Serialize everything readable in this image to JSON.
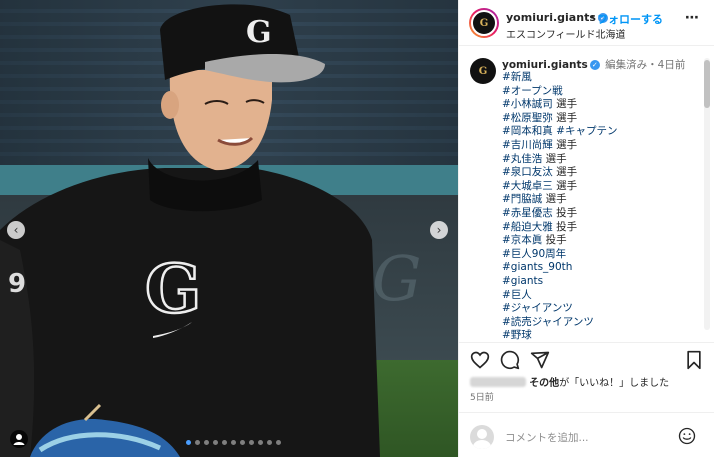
{
  "header": {
    "username": "yomiuri.giants",
    "separator": "•",
    "follow_label": "フォローする",
    "location": "エスコンフィールド北海道",
    "more_icon": "more-horizontal-icon"
  },
  "caption": {
    "username": "yomiuri.giants",
    "meta": "編集済み・4日前",
    "lines": [
      [
        {
          "text": "#新風",
          "hashtag": true
        }
      ],
      [
        {
          "text": "#オープン戦",
          "hashtag": true
        }
      ],
      [
        {
          "text": "#小林誠司",
          "hashtag": true
        },
        {
          "text": " 選手",
          "hashtag": false
        }
      ],
      [
        {
          "text": "#松原聖弥",
          "hashtag": true
        },
        {
          "text": " 選手",
          "hashtag": false
        }
      ],
      [
        {
          "text": "#岡本和真",
          "hashtag": true
        },
        {
          "text": " ",
          "hashtag": false
        },
        {
          "text": "#キャプテン",
          "hashtag": true
        }
      ],
      [
        {
          "text": "#吉川尚輝",
          "hashtag": true
        },
        {
          "text": " 選手",
          "hashtag": false
        }
      ],
      [
        {
          "text": "#丸佳浩",
          "hashtag": true
        },
        {
          "text": " 選手",
          "hashtag": false
        }
      ],
      [
        {
          "text": "#泉口友汰",
          "hashtag": true
        },
        {
          "text": " 選手",
          "hashtag": false
        }
      ],
      [
        {
          "text": "#大城卓三",
          "hashtag": true
        },
        {
          "text": " 選手",
          "hashtag": false
        }
      ],
      [
        {
          "text": "#門脇誠",
          "hashtag": true
        },
        {
          "text": " 選手",
          "hashtag": false
        }
      ],
      [
        {
          "text": "#赤星優志",
          "hashtag": true
        },
        {
          "text": " 投手",
          "hashtag": false
        }
      ],
      [
        {
          "text": "#船迫大雅",
          "hashtag": true
        },
        {
          "text": " 投手",
          "hashtag": false
        }
      ],
      [
        {
          "text": "#京本眞",
          "hashtag": true
        },
        {
          "text": " 投手",
          "hashtag": false
        }
      ],
      [
        {
          "text": "#巨人90周年",
          "hashtag": true
        }
      ],
      [
        {
          "text": "#giants_90th",
          "hashtag": true
        }
      ],
      [
        {
          "text": "#giants",
          "hashtag": true
        }
      ],
      [
        {
          "text": "#巨人",
          "hashtag": true
        }
      ],
      [
        {
          "text": "#ジャイアンツ",
          "hashtag": true
        }
      ],
      [
        {
          "text": "#読売ジャイアンツ",
          "hashtag": true
        }
      ],
      [
        {
          "text": "#野球",
          "hashtag": true
        }
      ]
    ]
  },
  "likes": {
    "suffix_bold": "その他",
    "suffix": "が「いいね！」しました"
  },
  "posted_ago": "5日前",
  "comment": {
    "placeholder": "コメントを追加..."
  },
  "carousel": {
    "prev": "‹",
    "next": "›",
    "dot_count": 11,
    "active_index": 0
  },
  "colors": {
    "link": "#0095f6",
    "hashtag": "#00376b",
    "text": "#262626",
    "muted": "#737373"
  }
}
